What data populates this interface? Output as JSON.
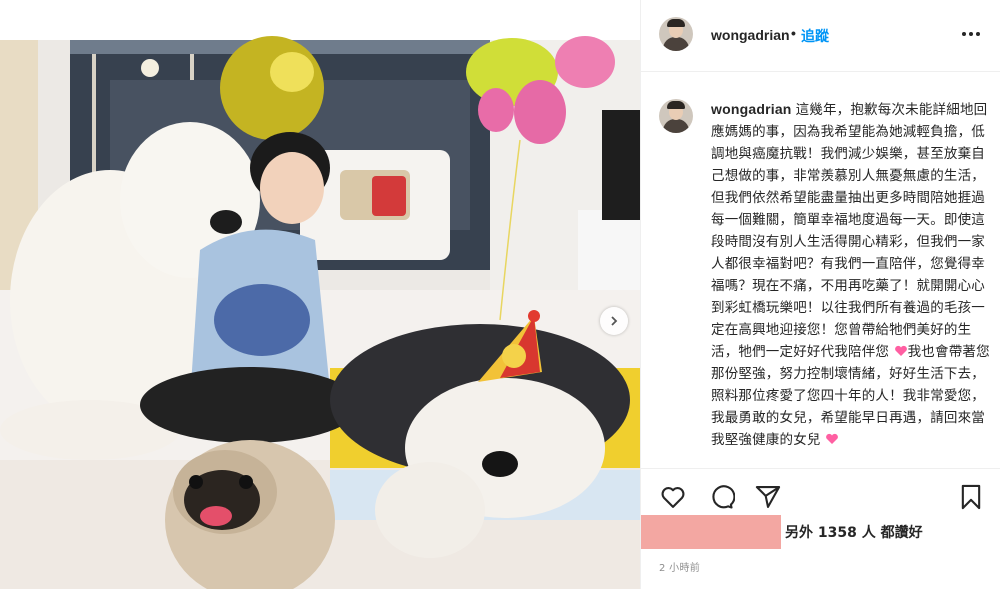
{
  "post": {
    "username": "wongadrian",
    "separator": "•",
    "follow_label": "追蹤",
    "caption_text": "這幾年，抱歉每次未能詳細地回應媽媽的事，因為我希望能為她減輕負擔，低調地與癌魔抗戰！我們減少娛樂，甚至放棄自己想做的事，非常羨慕別人無憂無慮的生活，但我們依然希望能盡量抽出更多時間陪她捱過每一個難關，簡單幸福地度過每一天。即使這段時間沒有別人生活得開心精彩，但我們一家人都很幸福對吧？有我們一直陪伴，您覺得幸福嗎？現在不痛，不用再吃藥了！就開開心心到彩虹橋玩樂吧！以往我們所有養過的毛孩一定在高興地迎接您！您曾帶給牠們美好的生活，牠們一定好好代我陪伴您",
    "caption_text_2": "我也會帶著您那份堅強，努力控制壞情緒，好好生活下去，照料那位疼愛了您四十年的人！我非常愛您，我最勇敢的女兒，希望能早日再遇，請回來當我堅強健康的女兒",
    "likes_text": "另外 1358 人 都讚好",
    "time_ago": "2 小時前"
  },
  "icons": {
    "more": "more-options-icon",
    "like": "heart-icon",
    "comment": "comment-icon",
    "share": "paper-plane-icon",
    "save": "bookmark-icon",
    "next": "chevron-right-icon",
    "emoji": "pink-heart-emoji"
  },
  "colors": {
    "follow": "#0095f6",
    "text": "#262626",
    "muted": "#8e8e8e",
    "heart_emoji": "#ff5fa2",
    "redaction_box": "#f3a7a2"
  }
}
